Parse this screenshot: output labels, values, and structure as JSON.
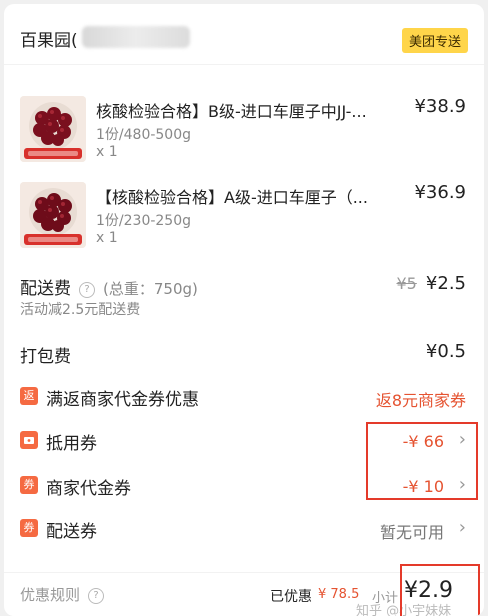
{
  "header": {
    "store_name": "百果园(",
    "delivery_badge": "美团专送"
  },
  "products": [
    {
      "title": "核酸检验合格】B级-进口车厘子中JJ-...",
      "spec": "1份/480-500g",
      "qty": "x 1",
      "price": "¥38.9"
    },
    {
      "title": "【核酸检验合格】A级-进口车厘子（...",
      "spec": "1份/230-250g",
      "qty": "x 1",
      "price": "¥36.9"
    }
  ],
  "delivery_fee": {
    "label": "配送费",
    "weight": "(总重：750g)",
    "original": "¥5",
    "value": "¥2.5",
    "note": "活动减2.5元配送费"
  },
  "packing_fee": {
    "label": "打包费",
    "value": "¥0.5"
  },
  "rebate": {
    "icon_text": "返",
    "label": "满返商家代金券优惠",
    "value": "返8元商家券"
  },
  "discount_coupon": {
    "label": "抵用券",
    "value": "-¥ 66"
  },
  "merchant_voucher": {
    "icon_text": "券",
    "label": "商家代金券",
    "value": "-¥ 10"
  },
  "delivery_coupon": {
    "icon_text": "券",
    "label": "配送券",
    "value": "暂无可用"
  },
  "footer": {
    "rules_label": "优惠规则",
    "saved_label": "已优惠",
    "saved_value": "¥ 78.5",
    "total_label": "小计",
    "total_value": "¥2.9",
    "watermark": "知乎 @小宇妹妹"
  },
  "colors": {
    "accent_red": "#e55331",
    "badge_yellow": "#ffd54a",
    "annotation_red": "#e43a2a"
  }
}
